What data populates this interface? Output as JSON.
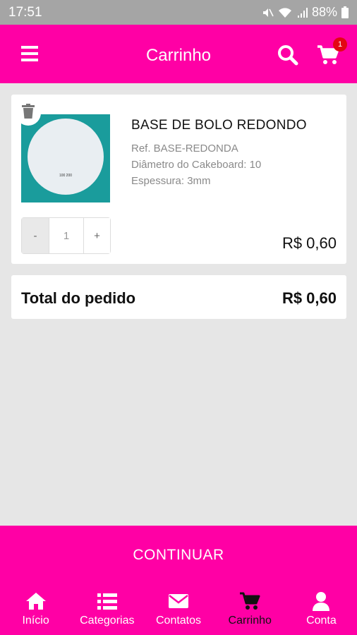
{
  "status": {
    "time": "17:51",
    "battery": "88%"
  },
  "header": {
    "title": "Carrinho",
    "cart_count": "1"
  },
  "cart": {
    "items": [
      {
        "name": "BASE DE BOLO REDONDO",
        "ref": "Ref. BASE-REDONDA",
        "diameter": "Diâmetro do Cakeboard: 10",
        "thickness": "Espessura: 3mm",
        "image_label": "100 200",
        "quantity": "1",
        "minus": "-",
        "plus": "+",
        "price": "R$ 0,60"
      }
    ],
    "total_label": "Total do pedido",
    "total_value": "R$ 0,60"
  },
  "continue_label": "CONTINUAR",
  "nav": [
    {
      "label": "Início",
      "icon": "home-icon"
    },
    {
      "label": "Categorias",
      "icon": "list-icon"
    },
    {
      "label": "Contatos",
      "icon": "mail-icon"
    },
    {
      "label": "Carrinho",
      "icon": "cart-icon"
    },
    {
      "label": "Conta",
      "icon": "user-icon"
    }
  ],
  "colors": {
    "brand": "#ff00a5",
    "badge": "#e30613",
    "image_bg": "#1a9c9c"
  }
}
